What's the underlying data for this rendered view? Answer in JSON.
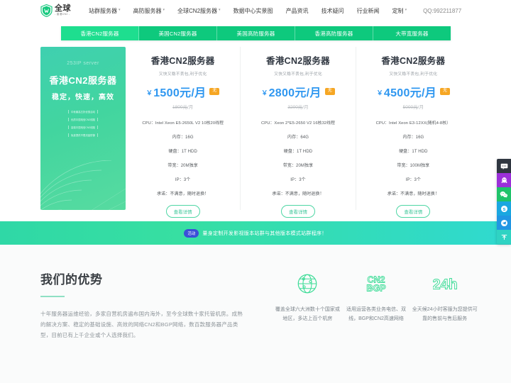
{
  "header": {
    "logo": {
      "main": "全球",
      "sub": "- 香港CN2 -",
      "icon": "shield-logo-icon"
    },
    "nav": [
      {
        "label": "站群服务器",
        "caret": "▾"
      },
      {
        "label": "高防服务器",
        "caret": "▾"
      },
      {
        "label": "全球CN2服务器",
        "caret": "▾"
      },
      {
        "label": "数据中心实景图",
        "caret": ""
      },
      {
        "label": "产品资讯",
        "caret": ""
      },
      {
        "label": "技术疑问",
        "caret": ""
      },
      {
        "label": "行业新闻",
        "caret": ""
      },
      {
        "label": "定制",
        "caret": "▾"
      }
    ],
    "qq": "QQ:992211877"
  },
  "tabs": [
    {
      "label": "香港CN2服务器",
      "active": true
    },
    {
      "label": "美国CN2服务器",
      "active": false
    },
    {
      "label": "美国高防服务器",
      "active": false
    },
    {
      "label": "香港高防服务器",
      "active": false
    },
    {
      "label": "大带宽服务器",
      "active": false
    }
  ],
  "banner": {
    "top_label": "253IP server",
    "heading": "香港CN2服务器",
    "subheading": "稳定，快速，高效",
    "features": [
      "中秋最高五折优惠活动",
      "优质中国电信CN2线路",
      "高端中国电信CN2线路",
      "免费提供不限流量防御"
    ]
  },
  "products": [
    {
      "title": "香港CN2服务器",
      "subtitle": "又快又稳不丢包,利于优化",
      "currency": "￥",
      "price": "1500元/月",
      "badge": "无",
      "price_old": "1800元",
      "price_old_unit": "/月",
      "specs": [
        "CPU：Intel Xeon E5-2650L V2 10核20线程",
        "内存：16G",
        "硬盘：1T HDD",
        "带宽：20M独享",
        "IP：3个",
        "承诺：不满意，随时退换！"
      ],
      "button": "查看详情"
    },
    {
      "title": "香港CN2服务器",
      "subtitle": "又快又稳不丢包,利于优化",
      "currency": "￥",
      "price": "2800元/月",
      "badge": "无",
      "price_old": "3200元",
      "price_old_unit": "/月",
      "specs": [
        "CPU：Xeon 2*E5-2650 V2 16核32线程",
        "内存：64G",
        "硬盘：1T HDD",
        "带宽：20M独享",
        "IP：3个",
        "承诺：不满意，随时退换！"
      ],
      "button": "查看详情"
    },
    {
      "title": "香港CN2服务器",
      "subtitle": "又快又稳不丢包,利于优化",
      "currency": "￥",
      "price": "4500元/月",
      "badge": "无",
      "price_old": "5000元",
      "price_old_unit": "/月",
      "specs": [
        "CPU：Intel Xeon E3-12XX(随机4-8核）",
        "内存：16G",
        "硬盘：1T HDD",
        "带宽：100M独享",
        "IP：3个",
        "承诺：不满意，随时退换！"
      ],
      "button": "查看详情"
    }
  ],
  "promo": {
    "badge": "活动",
    "text": "量身定制开发影视版本站群与其他版本模式站群程序！"
  },
  "advantages": {
    "title": "我们的优势",
    "description": "十年服务器运维经验，多家自营机房遍布国内海外，至今全球数十家托管机房。成熟的解决方案、稳定的基础设施、高效的网络CN2和BGP网络，数百款服务器产品类型，目前已有上千企业或个人选择我们。",
    "features": [
      {
        "icon": "globe-icon",
        "text": "覆盖全球六大洲数十个国家或地区，多达上百个机房"
      },
      {
        "icon": "cn2-bgp-icon",
        "text": "适用运营各类业务电信、双线，BGP和CN2高速网络"
      },
      {
        "icon": "24h-icon",
        "text": "全天候24小时客服为您提供可靠的售前与售后服务"
      }
    ]
  },
  "sidebar": [
    {
      "name": "message-icon",
      "color": "#2f3640"
    },
    {
      "name": "qq-penguin-icon",
      "color": "#9b30d9"
    },
    {
      "name": "wechat-icon",
      "color": "#1fc36a"
    },
    {
      "name": "skype-icon",
      "color": "#1aa7e0"
    },
    {
      "name": "telegram-icon",
      "color": "#2196e3"
    },
    {
      "name": "back-to-top-icon",
      "color": "#2fd3c3"
    }
  ],
  "colors": {
    "brand_green": "#0ec97d",
    "active_tab": "#1ede8f",
    "price_blue": "#2f97f0",
    "badge_orange": "#f6a623",
    "promo_blue": "#3b4fd8"
  }
}
